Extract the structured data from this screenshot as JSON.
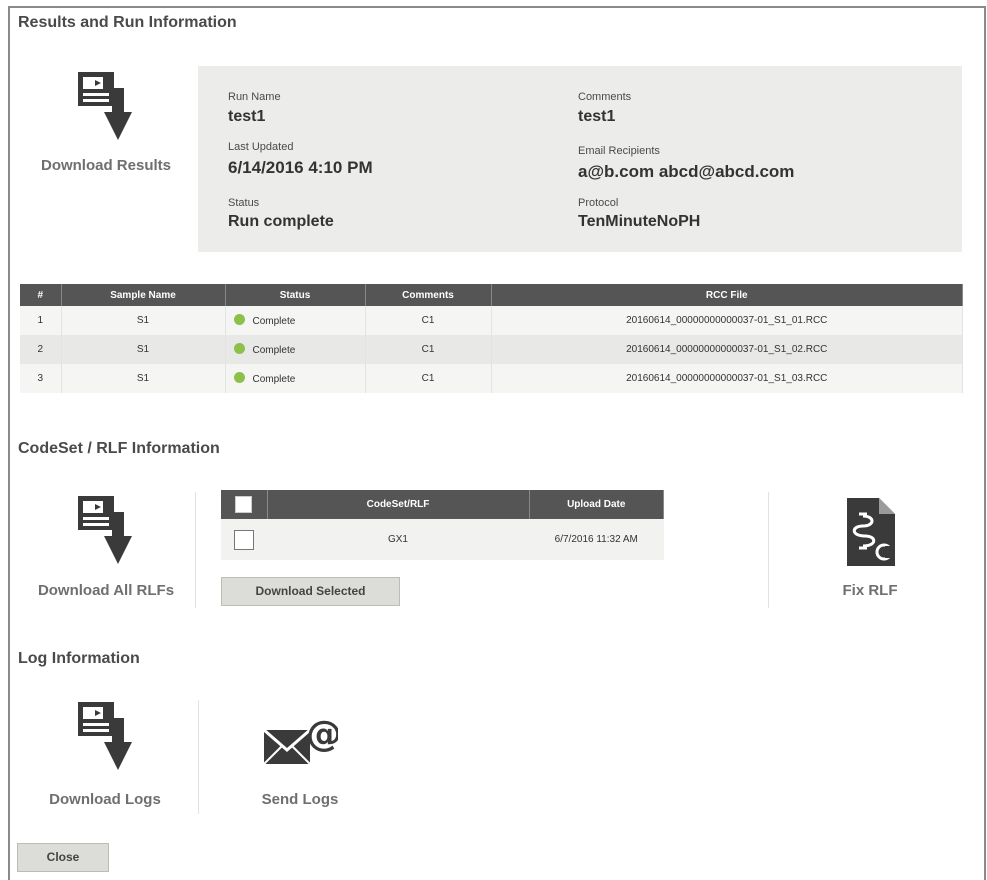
{
  "results": {
    "title": "Results and Run Information",
    "download_label": "Download Results",
    "run_name_label": "Run Name",
    "run_name": "test1",
    "last_updated_label": "Last Updated",
    "last_updated": "6/14/2016 4:10 PM",
    "status_label": "Status",
    "status": "Run complete",
    "comments_label": "Comments",
    "comments": "test1",
    "email_label": "Email Recipients",
    "email": "a@b.com abcd@abcd.com",
    "protocol_label": "Protocol",
    "protocol": "TenMinuteNoPH"
  },
  "samples": {
    "headers": [
      "#",
      "Sample Name",
      "Status",
      "Comments",
      "RCC File"
    ],
    "rows": [
      {
        "num": "1",
        "name": "S1",
        "status": "Complete",
        "comments": "C1",
        "file": "20160614_00000000000037-01_S1_01.RCC"
      },
      {
        "num": "2",
        "name": "S1",
        "status": "Complete",
        "comments": "C1",
        "file": "20160614_00000000000037-01_S1_02.RCC"
      },
      {
        "num": "3",
        "name": "S1",
        "status": "Complete",
        "comments": "C1",
        "file": "20160614_00000000000037-01_S1_03.RCC"
      }
    ],
    "status_color": "#8cc04a"
  },
  "codeset": {
    "title": "CodeSet / RLF Information",
    "download_all_label": "Download All RLFs",
    "headers": [
      "CodeSet/RLF",
      "Upload Date"
    ],
    "rows": [
      {
        "name": "GX1",
        "date": "6/7/2016 11:32 AM"
      }
    ],
    "download_selected_label": "Download Selected",
    "fix_label": "Fix RLF"
  },
  "log": {
    "title": "Log Information",
    "download_label": "Download Logs",
    "send_label": "Send Logs"
  },
  "close_label": "Close",
  "icons": [
    "download-icon",
    "fix-rlf-icon",
    "email-at-icon"
  ]
}
